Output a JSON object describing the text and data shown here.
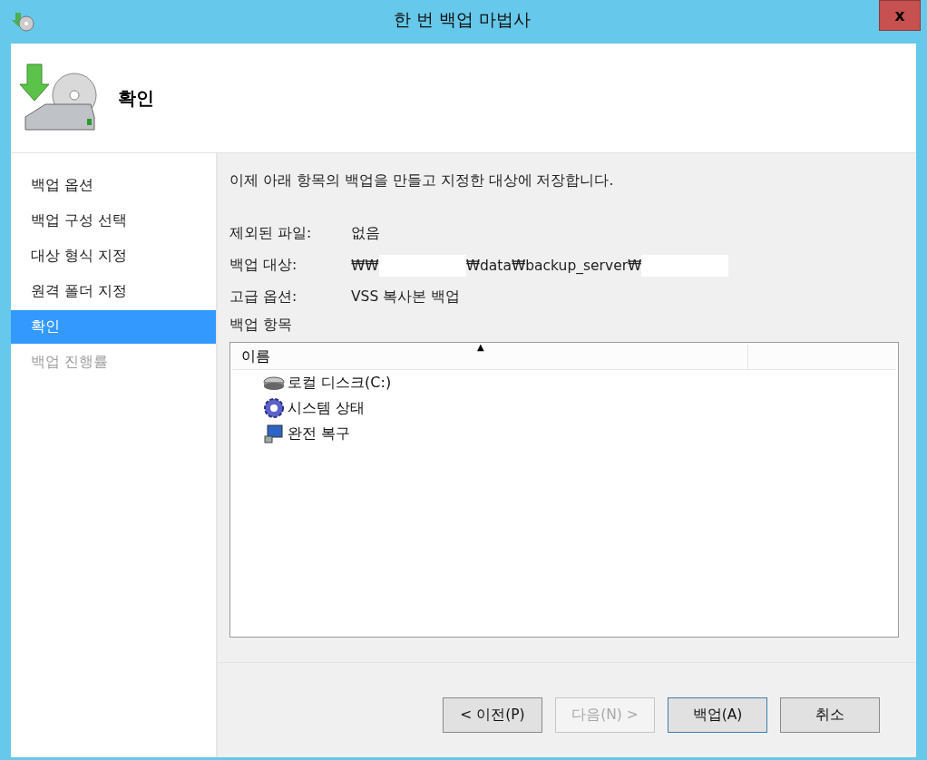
{
  "window": {
    "title": "한 번 백업 마법사",
    "close": "x"
  },
  "header": {
    "title": "확인"
  },
  "steps": [
    {
      "label": "백업 옵션",
      "selected": false,
      "disabled": false
    },
    {
      "label": "백업 구성 선택",
      "selected": false,
      "disabled": false
    },
    {
      "label": "대상 형식 지정",
      "selected": false,
      "disabled": false
    },
    {
      "label": "원격 폴더 지정",
      "selected": false,
      "disabled": false
    },
    {
      "label": "확인",
      "selected": true,
      "disabled": false
    },
    {
      "label": "백업 진행률",
      "selected": false,
      "disabled": true
    }
  ],
  "intro": "이제 아래 항목의 백업을 만들고 지정한 대상에 저장합니다.",
  "details": [
    {
      "label": "제외된 파일:",
      "parts": [
        {
          "kind": "text",
          "text": "없음"
        }
      ]
    },
    {
      "label": "백업 대상:",
      "parts": [
        {
          "kind": "text",
          "text": "₩₩"
        },
        {
          "kind": "redacted"
        },
        {
          "kind": "text",
          "text": "₩data₩backup_server₩"
        },
        {
          "kind": "redacted"
        }
      ]
    },
    {
      "label": "고급 옵션:",
      "parts": [
        {
          "kind": "text",
          "text": "VSS 복사본 백업"
        }
      ]
    }
  ],
  "items_label": "백업 항목",
  "items_list": {
    "column": "이름",
    "sort_mark": "▲",
    "rows": [
      {
        "kind": "disk",
        "name": "로컬 디스크(C:)"
      },
      {
        "kind": "system",
        "name": "시스템 상태"
      },
      {
        "kind": "recovery",
        "name": "완전 복구"
      }
    ]
  },
  "buttons": [
    {
      "label": "< 이전(P)",
      "disabled": false,
      "default": false
    },
    {
      "label": "다음(N) >",
      "disabled": true,
      "default": false
    },
    {
      "label": "백업(A)",
      "disabled": false,
      "default": true
    },
    {
      "label": "취소",
      "disabled": false,
      "default": false
    }
  ]
}
